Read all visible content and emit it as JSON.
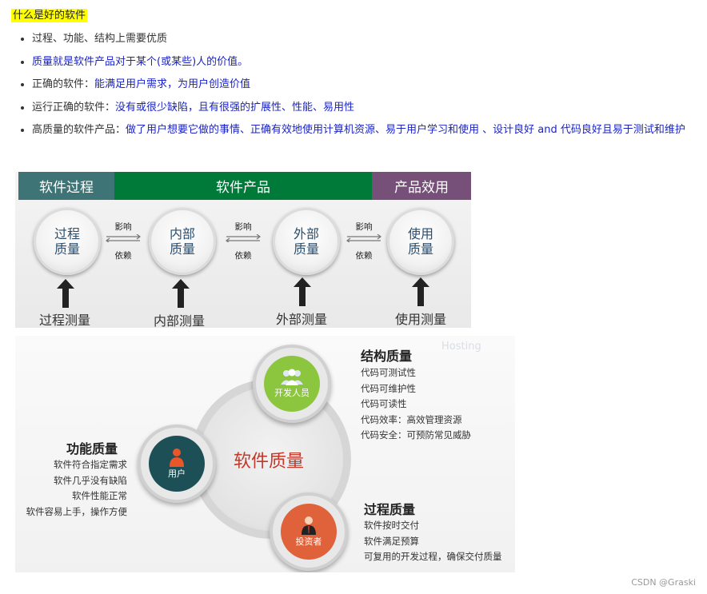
{
  "heading": "什么是好的软件",
  "bullets": [
    {
      "prefix": "",
      "text": "过程、功能、结构上需要优质"
    },
    {
      "prefix": "",
      "text": "质量就是软件产品对于某个(或某些)人的价值。"
    },
    {
      "prefix": "正确的软件：",
      "text": "能满足用户需求，为用户创造价值"
    },
    {
      "prefix": "运行正确的软件：",
      "text": "没有或很少缺陷，且有很强的扩展性、性能、易用性"
    },
    {
      "prefix": "高质量的软件产品：",
      "text": "做了用户想要它做的事情、正确有效地使用计算机资源、易于用户学习和使用 、设计良好 and 代码良好且易于测试和维护"
    }
  ],
  "diagram1": {
    "headers": [
      "软件过程",
      "软件产品",
      "产品效用"
    ],
    "nodes": [
      {
        "line1": "过程",
        "line2": "质量"
      },
      {
        "line1": "内部",
        "line2": "质量"
      },
      {
        "line1": "外部",
        "line2": "质量"
      },
      {
        "line1": "使用",
        "line2": "质量"
      }
    ],
    "arrow_top": "影响",
    "arrow_bottom": "依赖",
    "measures": [
      "过程测量",
      "内部测量",
      "外部测量",
      "使用测量"
    ]
  },
  "diagram2": {
    "center": "软件质量",
    "hosting": "Hosting",
    "nodes": {
      "developer": {
        "label": "开发人员",
        "color": "#8cc63f"
      },
      "user": {
        "label": "用户",
        "color": "#1d4f57"
      },
      "investor": {
        "label": "投资者",
        "color": "#e0623b"
      }
    },
    "structure": {
      "title": "结构质量",
      "items": [
        "代码可测试性",
        "代码可维护性",
        "代码可读性",
        "代码效率：高效管理资源",
        "代码安全：可预防常见威胁"
      ]
    },
    "function": {
      "title": "功能质量",
      "items": [
        "软件符合指定需求",
        "软件几乎没有缺陷",
        "软件性能正常",
        "软件容易上手，操作方便"
      ]
    },
    "process": {
      "title": "过程质量",
      "items": [
        "软件按时交付",
        "软件满足预算",
        "可复用的开发过程，确保交付质量"
      ]
    }
  },
  "watermark": "CSDN @Graski"
}
